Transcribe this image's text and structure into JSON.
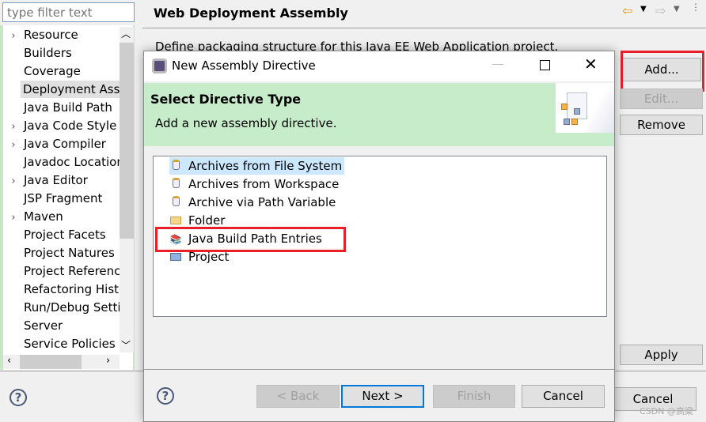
{
  "filter": {
    "placeholder": "type filter text"
  },
  "tree": {
    "items": [
      {
        "label": "Resource",
        "expandable": true
      },
      {
        "label": "Builders",
        "expandable": false
      },
      {
        "label": "Coverage",
        "expandable": false
      },
      {
        "label": "Deployment Assembly",
        "expandable": false,
        "selected": true
      },
      {
        "label": "Java Build Path",
        "expandable": false
      },
      {
        "label": "Java Code Style",
        "expandable": true
      },
      {
        "label": "Java Compiler",
        "expandable": true
      },
      {
        "label": "Javadoc Location",
        "expandable": false
      },
      {
        "label": "Java Editor",
        "expandable": true
      },
      {
        "label": "JSP Fragment",
        "expandable": false
      },
      {
        "label": "Maven",
        "expandable": true
      },
      {
        "label": "Project Facets",
        "expandable": false
      },
      {
        "label": "Project Natures",
        "expandable": false
      },
      {
        "label": "Project References",
        "expandable": false
      },
      {
        "label": "Refactoring History",
        "expandable": false
      },
      {
        "label": "Run/Debug Settings",
        "expandable": false
      },
      {
        "label": "Server",
        "expandable": false
      },
      {
        "label": "Service Policies",
        "expandable": false
      }
    ]
  },
  "page": {
    "title": "Web Deployment Assembly",
    "description": "Define packaging structure for this Java EE Web Application project."
  },
  "buttons": {
    "add": "Add...",
    "edit": "Edit...",
    "remove": "Remove",
    "apply": "Apply",
    "cancel": "Cancel"
  },
  "dialog": {
    "title": "New Assembly Directive",
    "header_title": "Select Directive Type",
    "header_desc": "Add a new assembly directive.",
    "items": [
      {
        "label": "Archives from File System",
        "icon": "jar-icon",
        "selected": true
      },
      {
        "label": "Archives from Workspace",
        "icon": "jar-icon"
      },
      {
        "label": "Archive via Path Variable",
        "icon": "jar-icon"
      },
      {
        "label": "Folder",
        "icon": "folder-icon"
      },
      {
        "label": "Java Build Path Entries",
        "icon": "library-icon"
      },
      {
        "label": "Project",
        "icon": "project-icon"
      }
    ],
    "back": "< Back",
    "next": "Next >",
    "finish": "Finish",
    "cancel": "Cancel"
  },
  "watermark": "CSDN @高粱",
  "colors": {
    "header_green": "#c6ecc9",
    "highlight": "#e8202a",
    "selection": "#cce8ff"
  }
}
